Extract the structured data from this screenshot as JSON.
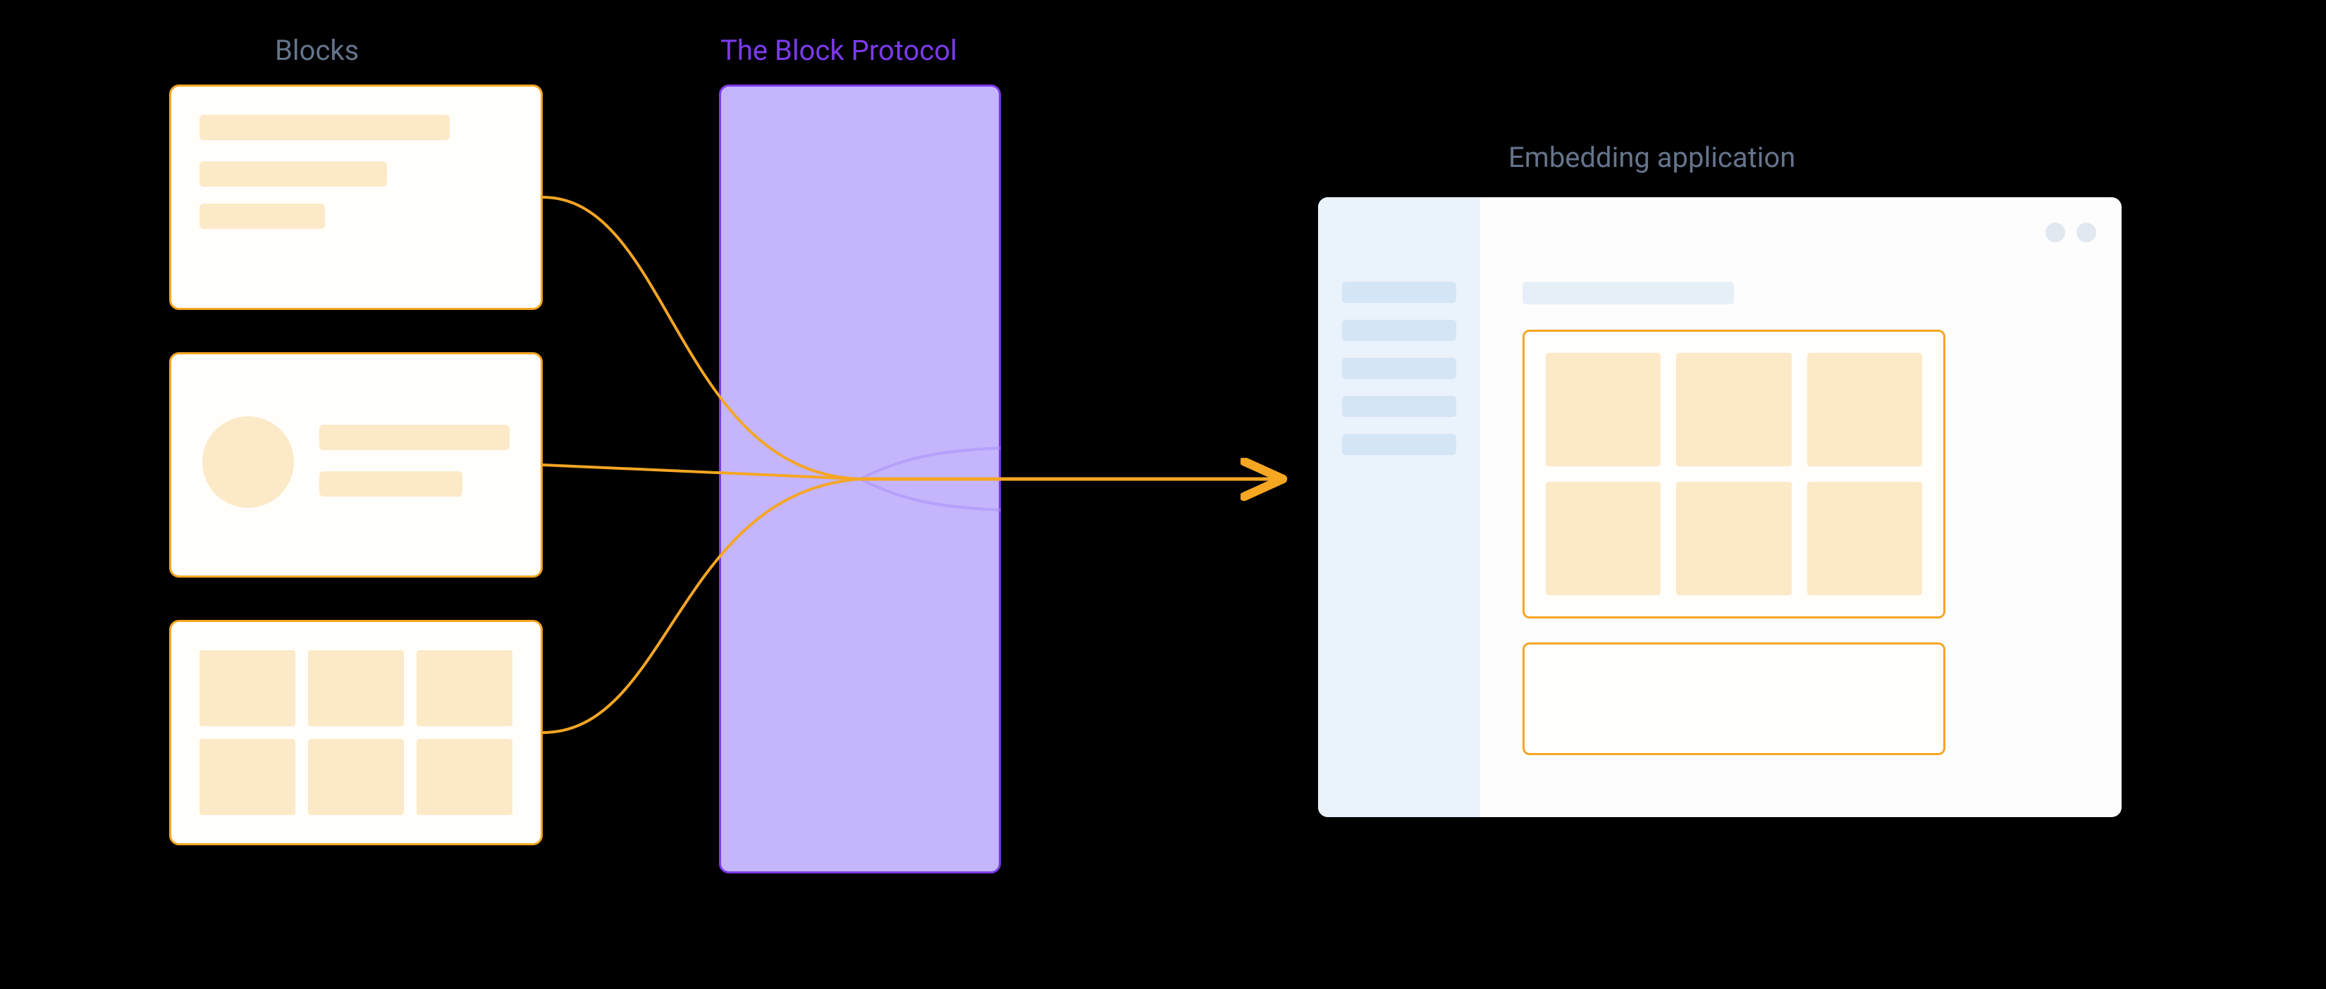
{
  "labels": {
    "blocks": "Blocks",
    "protocol": "The Block Protocol",
    "app": "Embedding application"
  },
  "colors": {
    "accent_orange": "#f5a623",
    "accent_purple": "#7c3aed",
    "purple_fill": "#c4b5fd",
    "text_muted": "#64748b",
    "card_fill": "#fce9c8",
    "app_sidebar": "#eaf2fb"
  },
  "diagram": {
    "blocks": [
      "text-block",
      "profile-block",
      "grid-block"
    ],
    "protocol": "block-protocol",
    "application": {
      "sidebar_items": 5,
      "window_dots": 2,
      "embedded_blocks": [
        "grid-block",
        "empty-block"
      ]
    },
    "flows": [
      {
        "from": "text-block",
        "to": "block-protocol"
      },
      {
        "from": "profile-block",
        "to": "block-protocol"
      },
      {
        "from": "grid-block",
        "to": "block-protocol"
      },
      {
        "from": "block-protocol",
        "to": "embedding-application"
      }
    ]
  }
}
